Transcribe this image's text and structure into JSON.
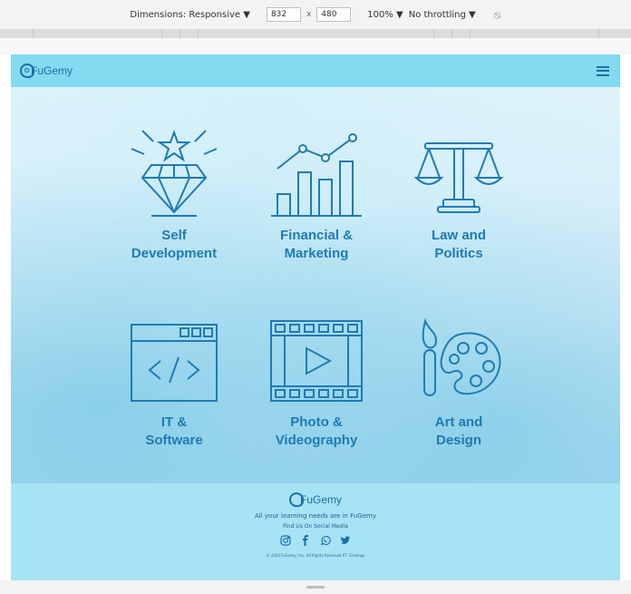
{
  "devtools": {
    "dimensions_label": "Dimensions: Responsive ▼",
    "width": "832",
    "times": "x",
    "height": "480",
    "zoom": "100% ▼",
    "throttling": "No throttling ▼",
    "rotate_icon": "rotate-icon"
  },
  "navbar": {
    "brand": "FuGemy",
    "menu_icon": "hamburger-icon"
  },
  "categories": [
    {
      "line1": "Self",
      "line2": "Development",
      "icon": "diamond-icon"
    },
    {
      "line1": "Financial &",
      "line2": "Marketing",
      "icon": "bar-chart-icon"
    },
    {
      "line1": "Law and",
      "line2": "Politics",
      "icon": "scales-icon"
    },
    {
      "line1": "IT &",
      "line2": "Software",
      "icon": "code-window-icon"
    },
    {
      "line1": "Photo &",
      "line2": "Videography",
      "icon": "film-icon"
    },
    {
      "line1": "Art and",
      "line2": "Design",
      "icon": "palette-icon"
    }
  ],
  "footer": {
    "brand": "FuGemy",
    "tagline": "All your learning needs are in FuGemy",
    "social_title": "Find Us On Social Media",
    "social_icons": [
      "instagram-icon",
      "facebook-icon",
      "whatsapp-icon",
      "twitter-icon"
    ],
    "copyright": "© 2020 FuGemy, Inc. All Rights Reserved PT. Greelogs"
  },
  "colors": {
    "navbar": "#82dbf0",
    "footer": "#a6e3f5",
    "accent": "#1f7bb5"
  }
}
